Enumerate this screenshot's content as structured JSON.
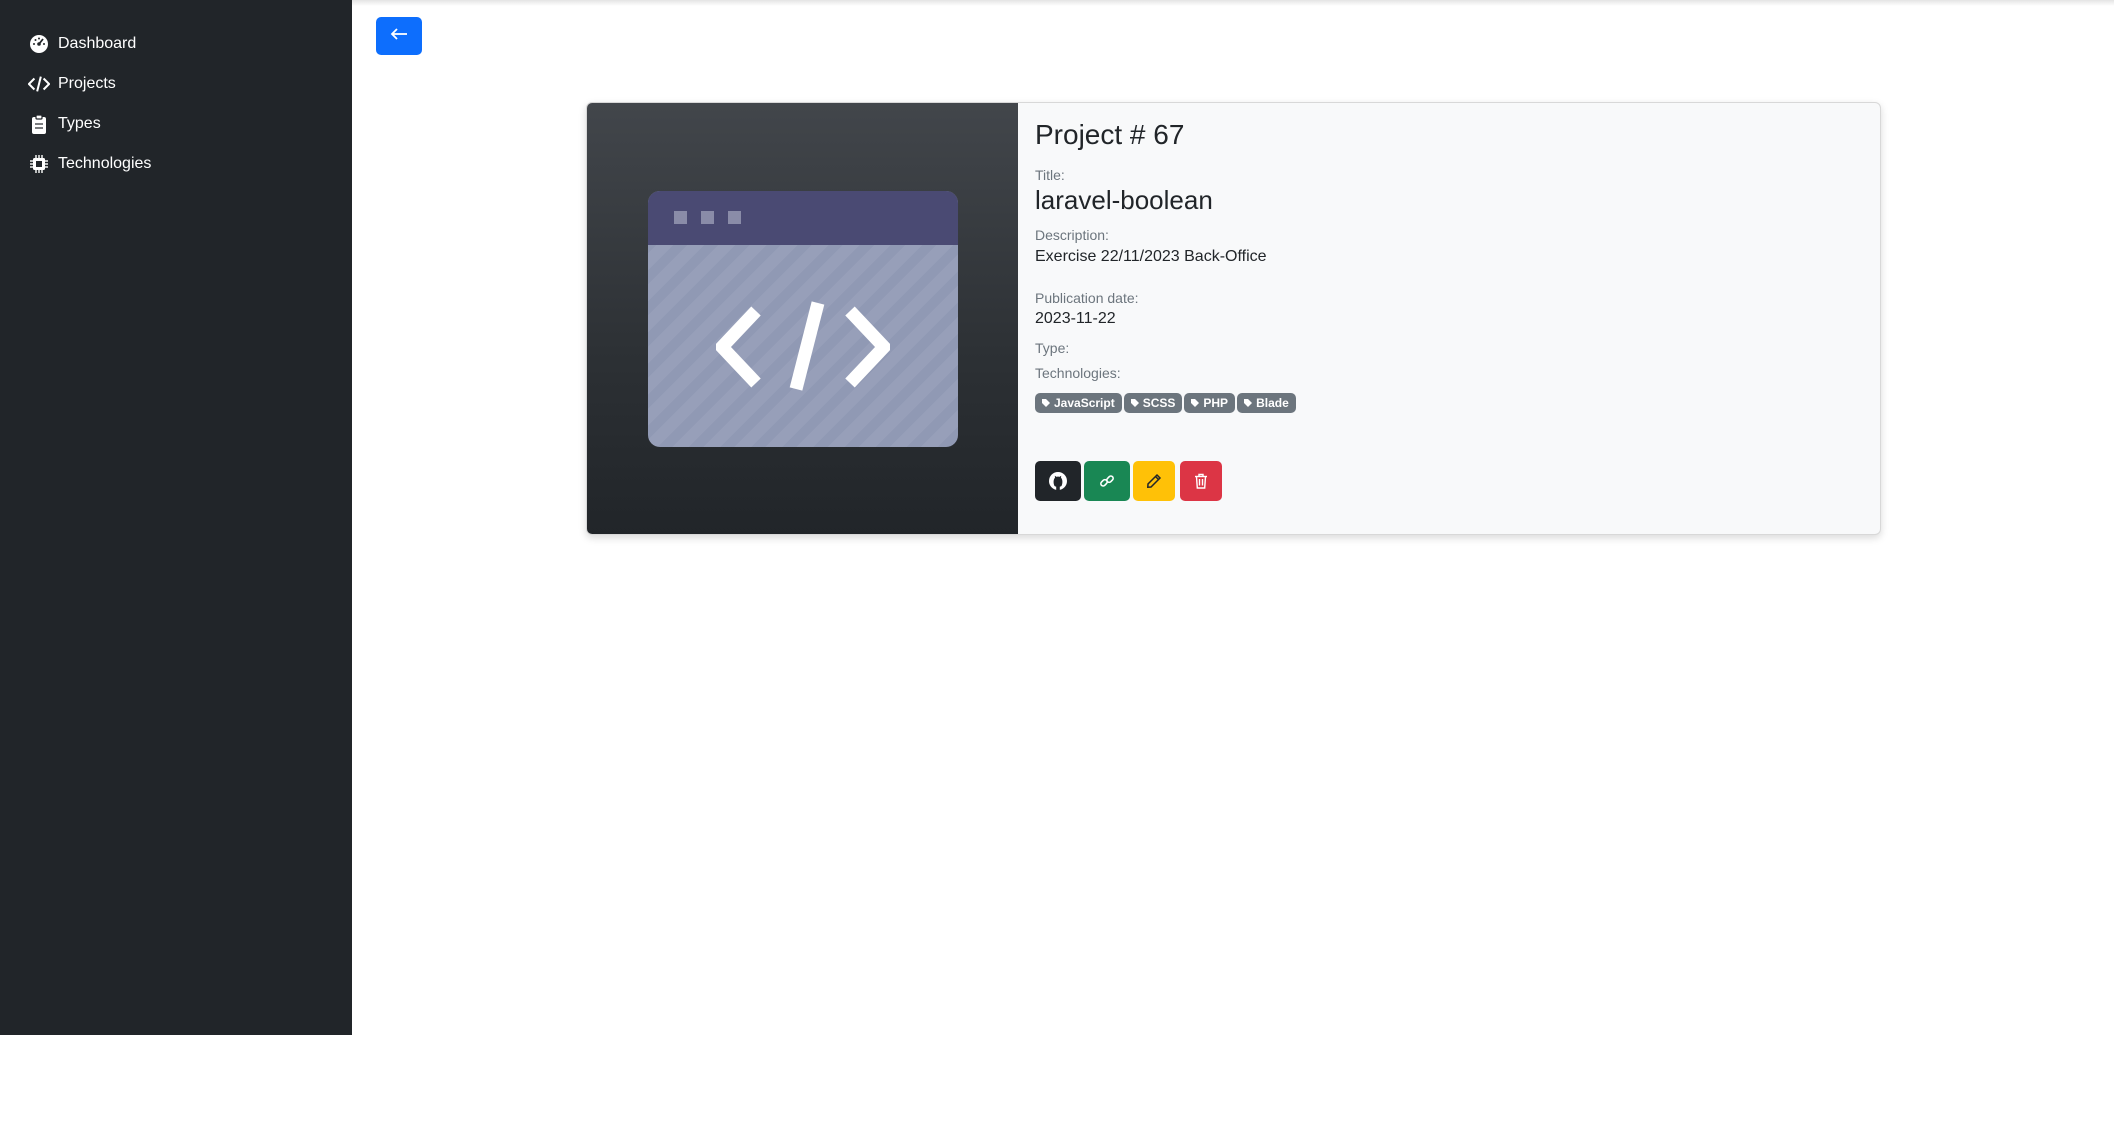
{
  "sidebar": {
    "items": [
      {
        "label": "Dashboard",
        "icon": "dashboard-icon"
      },
      {
        "label": "Projects",
        "icon": "code-icon"
      },
      {
        "label": "Types",
        "icon": "clipboard-icon"
      },
      {
        "label": "Technologies",
        "icon": "cpu-icon"
      }
    ]
  },
  "header": {
    "back_icon": "arrow-left-icon"
  },
  "project": {
    "heading": "Project # 67",
    "title_label": "Title:",
    "title": "laravel-boolean",
    "description_label": "Description:",
    "description": "Exercise 22/11/2023 Back-Office",
    "date_label": "Publication date:",
    "date": "2023-11-22",
    "type_label": "Type:",
    "type": "",
    "technologies_label": "Technologies:",
    "technologies": [
      "JavaScript",
      "SCSS",
      "PHP",
      "Blade"
    ]
  },
  "actions": [
    {
      "name": "github-button",
      "icon": "github-icon"
    },
    {
      "name": "link-button",
      "icon": "link-icon"
    },
    {
      "name": "edit-button",
      "icon": "pencil-icon"
    },
    {
      "name": "delete-button",
      "icon": "trash-icon"
    }
  ],
  "colors": {
    "sidebar_bg": "#212529",
    "primary": "#0d6efd",
    "success": "#198754",
    "warning": "#ffc107",
    "danger": "#dc3545",
    "badge": "#6c757d"
  }
}
